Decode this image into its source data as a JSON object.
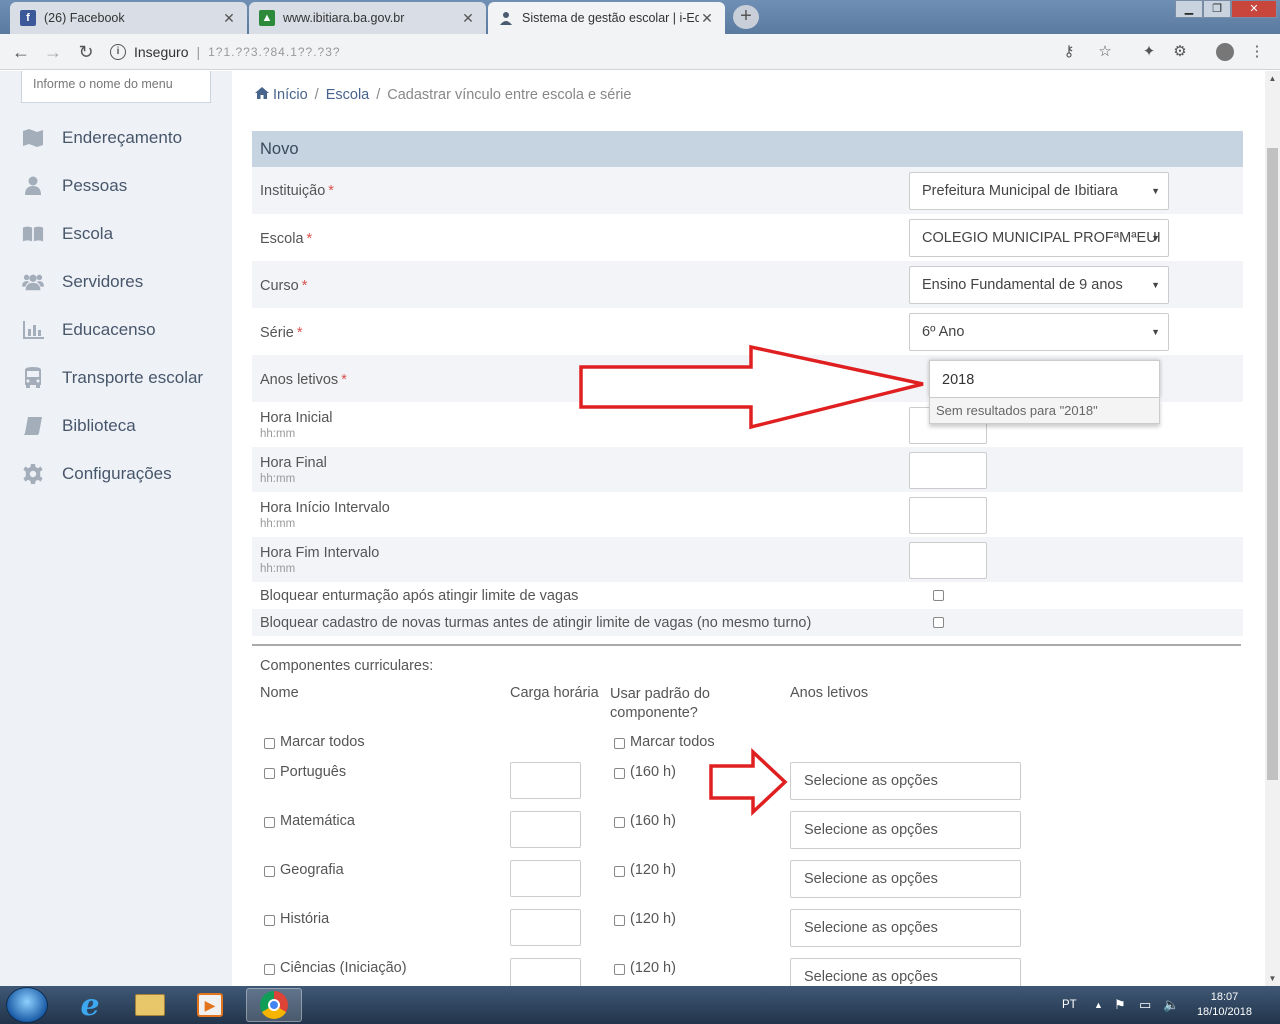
{
  "browser": {
    "tabs": [
      {
        "title": "(26) Facebook",
        "favicon": "facebook-icon"
      },
      {
        "title": "www.ibitiara.ba.gov.br",
        "favicon": "site-favicon"
      },
      {
        "title": "Sistema de gestão escolar | i-Edu",
        "favicon": "ieducar-favicon"
      }
    ],
    "address": {
      "security": "Inseguro",
      "url": "1?1.??3.?84.1??.?3?"
    },
    "active_tab": 2
  },
  "sidebar": {
    "search_placeholder": "Informe o nome do menu",
    "items": [
      {
        "label": "Endereçamento",
        "icon": "map-icon"
      },
      {
        "label": "Pessoas",
        "icon": "user-icon"
      },
      {
        "label": "Escola",
        "icon": "book-open-icon"
      },
      {
        "label": "Servidores",
        "icon": "users-icon"
      },
      {
        "label": "Educacenso",
        "icon": "bar-chart-icon"
      },
      {
        "label": "Transporte escolar",
        "icon": "bus-icon"
      },
      {
        "label": "Biblioteca",
        "icon": "book-icon"
      },
      {
        "label": "Configurações",
        "icon": "gear-icon"
      }
    ]
  },
  "breadcrumb": {
    "home": "Início",
    "section": "Escola",
    "current": "Cadastrar vínculo entre escola e série",
    "sep": "/"
  },
  "form": {
    "title": "Novo",
    "required_mark": "*",
    "instituicao": {
      "label": "Instituição",
      "value": "Prefeitura Municipal de Ibitiara"
    },
    "escola": {
      "label": "Escola",
      "value": "COLEGIO MUNICIPAL PROFªMªEUI"
    },
    "curso": {
      "label": "Curso",
      "value": "Ensino Fundamental de 9 anos"
    },
    "serie": {
      "label": "Série",
      "value": "6º Ano"
    },
    "anos_letivos": {
      "label": "Anos letivos",
      "value": "2018",
      "no_results": "Sem resultados para \"2018\""
    },
    "hora_inicial": {
      "label": "Hora Inicial",
      "hint": "hh:mm"
    },
    "hora_final": {
      "label": "Hora Final",
      "hint": "hh:mm"
    },
    "hora_inicio_intervalo": {
      "label": "Hora Início Intervalo",
      "hint": "hh:mm"
    },
    "hora_fim_intervalo": {
      "label": "Hora Fim Intervalo",
      "hint": "hh:mm"
    },
    "bloquear_enturmacao": {
      "label": "Bloquear enturmação após atingir limite de vagas",
      "checked": false
    },
    "bloquear_turmas": {
      "label": "Bloquear cadastro de novas turmas antes de atingir limite de vagas (no mesmo turno)",
      "checked": false
    }
  },
  "componentes": {
    "title": "Componentes curriculares:",
    "headers": {
      "nome": "Nome",
      "carga": "Carga horária",
      "padrao": "Usar padrão do componente?",
      "anos": "Anos letivos"
    },
    "marcar_todos": "Marcar todos",
    "multiselect_placeholder": "Selecione as opções",
    "rows": [
      {
        "nome": "Português",
        "padrao": "(160 h)"
      },
      {
        "nome": "Matemática",
        "padrao": "(160 h)"
      },
      {
        "nome": "Geografia",
        "padrao": "(120 h)"
      },
      {
        "nome": "História",
        "padrao": "(120 h)"
      },
      {
        "nome": "Ciências (Iniciação)",
        "padrao": "(120 h)"
      }
    ]
  },
  "annotations": {
    "arrow_color": "#e02020"
  },
  "taskbar": {
    "language": "PT",
    "time": "18:07",
    "date": "18/10/2018"
  }
}
